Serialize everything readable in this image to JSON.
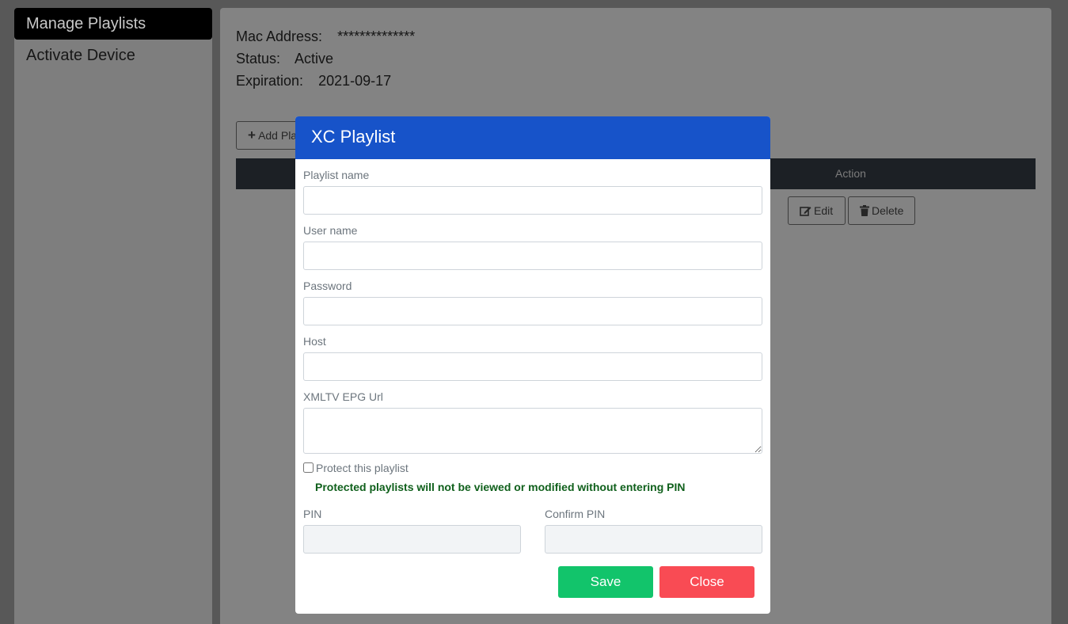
{
  "sidebar": {
    "items": [
      {
        "label": "Manage Playlists",
        "active": true
      },
      {
        "label": "Activate Device",
        "active": false
      }
    ]
  },
  "device_info": {
    "mac_label": "Mac Address:",
    "mac_value": "**************",
    "status_label": "Status:",
    "status_value": "Active",
    "expiration_label": "Expiration:",
    "expiration_value": "2021-09-17"
  },
  "playlist_table": {
    "add_button_label": "Add Pla",
    "header_action": "Action",
    "edit_label": "Edit",
    "delete_label": "Delete"
  },
  "modal": {
    "title": "XC Playlist",
    "fields": {
      "playlist_name_label": "Playlist name",
      "playlist_name_value": "",
      "user_name_label": "User name",
      "user_name_value": "",
      "password_label": "Password",
      "password_value": "",
      "host_label": "Host",
      "host_value": "",
      "epg_label": "XMLTV EPG Url",
      "epg_value": ""
    },
    "protect_label": "Protect this playlist",
    "protect_checked": false,
    "protect_hint": "Protected playlists will not be viewed or modified without entering PIN",
    "pin_label": "PIN",
    "confirm_pin_label": "Confirm PIN",
    "save_label": "Save",
    "close_label": "Close"
  },
  "colors": {
    "modal_header": "#1753c9",
    "save_button": "#12c46b",
    "close_button": "#f94b54",
    "hint_text": "#10601c"
  }
}
